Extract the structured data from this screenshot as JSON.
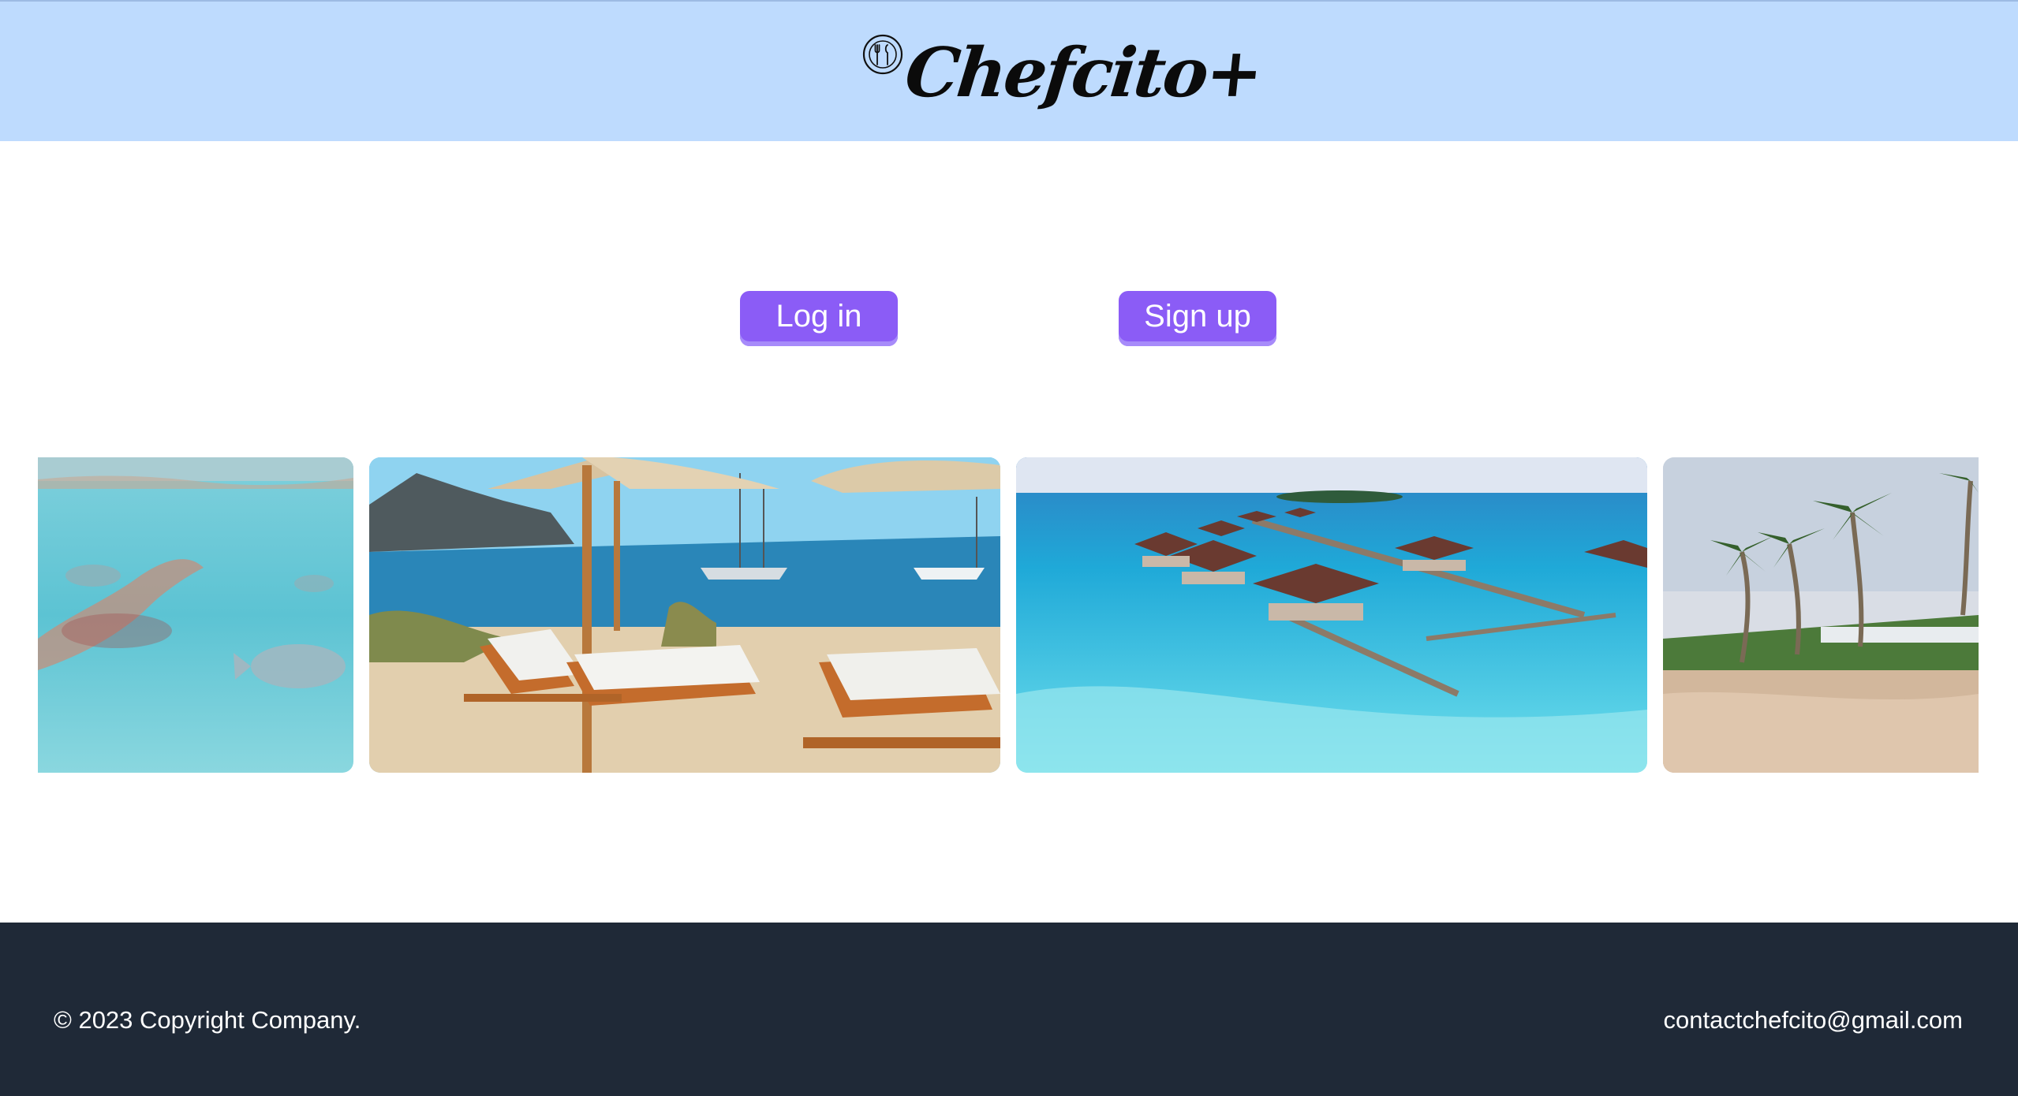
{
  "header": {
    "brand_name": "Chefcito+",
    "brand_icon": "plate-utensils-icon",
    "background_color": "#bedbfe"
  },
  "auth": {
    "login_label": "Log in",
    "signup_label": "Sign up",
    "button_color": "#8b5cf6"
  },
  "carousel": {
    "slides": [
      {
        "subject": "underwater-swimmer-with-fish"
      },
      {
        "subject": "beach-loungers-with-umbrellas-and-sailboats"
      },
      {
        "subject": "overwater-bungalows-over-turquoise-lagoon"
      },
      {
        "subject": "palm-trees-on-sandy-beach"
      }
    ]
  },
  "footer": {
    "copyright": "© 2023 Copyright Company.",
    "email": "contactchefcito@gmail.com",
    "background_color": "#1f2937"
  }
}
